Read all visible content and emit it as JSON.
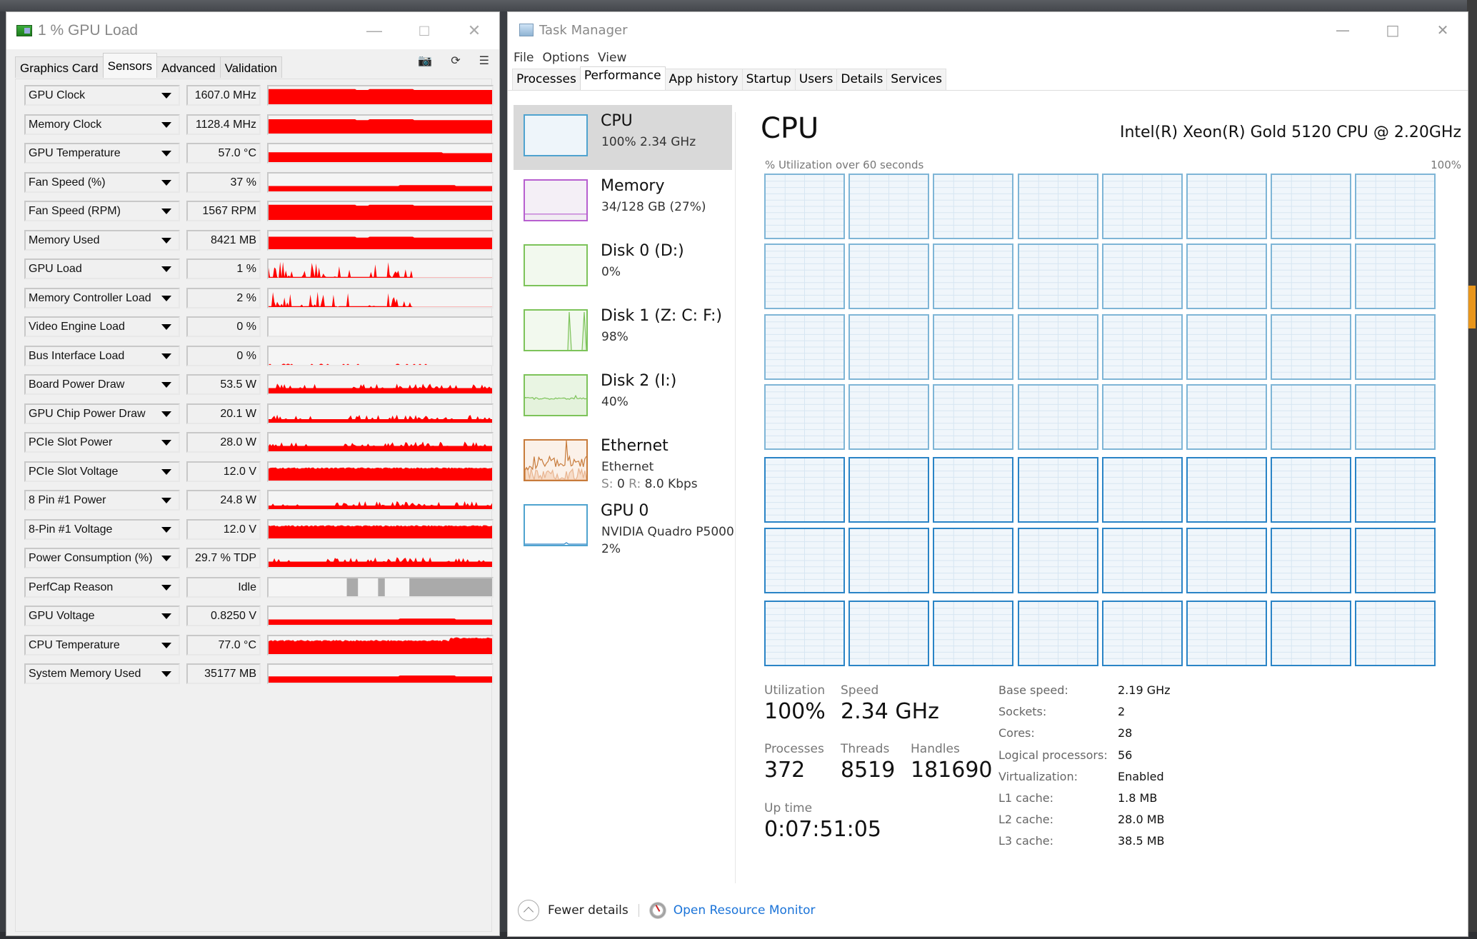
{
  "gpuz": {
    "title": "1 % GPU Load",
    "tabs": [
      {
        "label": "Graphics Card",
        "active": false
      },
      {
        "label": "Sensors",
        "active": true
      },
      {
        "label": "Advanced",
        "active": false
      },
      {
        "label": "Validation",
        "active": false
      }
    ],
    "tool_icons": [
      "camera-icon",
      "refresh-icon",
      "menu-icon"
    ],
    "graph_color": "#ff0000",
    "sensors": [
      {
        "name": "GPU Clock",
        "value": "1607.0 MHz",
        "graph": "flat-high",
        "level": 0.85
      },
      {
        "name": "Memory Clock",
        "value": "1128.4 MHz",
        "graph": "flat-high",
        "level": 0.8
      },
      {
        "name": "GPU Temperature",
        "value": "57.0 °C",
        "graph": "flat-mid",
        "level": 0.55
      },
      {
        "name": "Fan Speed (%)",
        "value": "37 %",
        "graph": "flat-low",
        "level": 0.3
      },
      {
        "name": "Fan Speed (RPM)",
        "value": "1567 RPM",
        "graph": "flat-high",
        "level": 0.85
      },
      {
        "name": "Memory Used",
        "value": "8421 MB",
        "graph": "flat-high",
        "level": 0.7
      },
      {
        "name": "GPU Load",
        "value": "1 %",
        "graph": "spiky",
        "level": 0.02
      },
      {
        "name": "Memory Controller Load",
        "value": "2 %",
        "graph": "spiky",
        "level": 0.05
      },
      {
        "name": "Video Engine Load",
        "value": "0 %",
        "graph": "empty",
        "level": 0
      },
      {
        "name": "Bus Interface Load",
        "value": "0 %",
        "graph": "dots",
        "level": 0.02
      },
      {
        "name": "Board Power Draw",
        "value": "53.5 W",
        "graph": "power",
        "level": 0.3
      },
      {
        "name": "GPU Chip Power Draw",
        "value": "20.1 W",
        "graph": "power",
        "level": 0.2
      },
      {
        "name": "PCIe Slot Power",
        "value": "28.0 W",
        "graph": "power",
        "level": 0.3
      },
      {
        "name": "PCIe Slot Voltage",
        "value": "12.0 V",
        "graph": "noisy-high",
        "level": 0.7
      },
      {
        "name": "8 Pin #1 Power",
        "value": "24.8 W",
        "graph": "power",
        "level": 0.2
      },
      {
        "name": "8-Pin #1 Voltage",
        "value": "12.0 V",
        "graph": "noisy-high",
        "level": 0.7
      },
      {
        "name": "Power Consumption (%)",
        "value": "29.7 % TDP",
        "graph": "power",
        "level": 0.3
      },
      {
        "name": "PerfCap Reason",
        "value": "Idle",
        "graph": "perfcap",
        "level": 0
      },
      {
        "name": "GPU Voltage",
        "value": "0.8250 V",
        "graph": "flat-low",
        "level": 0.3
      },
      {
        "name": "CPU Temperature",
        "value": "77.0 °C",
        "graph": "noisy-high",
        "level": 0.75
      },
      {
        "name": "System Memory Used",
        "value": "35177 MB",
        "graph": "flat-low",
        "level": 0.35
      }
    ]
  },
  "taskmanager": {
    "title": "Task Manager",
    "menu": [
      "File",
      "Options",
      "View"
    ],
    "tabs": [
      {
        "label": "Processes",
        "active": false
      },
      {
        "label": "Performance",
        "active": true
      },
      {
        "label": "App history",
        "active": false
      },
      {
        "label": "Startup",
        "active": false
      },
      {
        "label": "Users",
        "active": false
      },
      {
        "label": "Details",
        "active": false
      },
      {
        "label": "Services",
        "active": false
      }
    ],
    "sidebar": [
      {
        "label": "CPU",
        "sub": "100%  2.34 GHz",
        "color": "#4fa3cf",
        "fill": "#eef5fa",
        "active": true
      },
      {
        "label": "Memory",
        "sub": "34/128 GB (27%)",
        "color": "#b75fcf",
        "fill": "#f4eff6",
        "active": false,
        "usage": 0.27
      },
      {
        "label": "Disk 0 (D:)",
        "sub": "0%",
        "color": "#7dc35a",
        "fill": "#f2f9ee",
        "active": false,
        "usage": 0
      },
      {
        "label": "Disk 1 (Z: C: F:)",
        "sub": "98%",
        "color": "#7dc35a",
        "fill": "#f2f9ee",
        "active": false,
        "usage": 0.98
      },
      {
        "label": "Disk 2 (I:)",
        "sub": "40%",
        "color": "#7dc35a",
        "fill": "#e9f5e3",
        "active": false,
        "usage": 0.4
      },
      {
        "label": "Ethernet",
        "sub": "Ethernet",
        "sub2_send_label": "S:",
        "sub2_send": "0",
        "sub2_recv_label": "R:",
        "sub2_recv": "8.0 Kbps",
        "color": "#c77b3b",
        "fill": "#fbf1e9",
        "active": false
      },
      {
        "label": "GPU 0",
        "sub": "NVIDIA Quadro P5000",
        "sub2": "2%",
        "color": "#4fa3cf",
        "fill": "#ffffff",
        "active": false,
        "usage": 0.02
      }
    ],
    "main": {
      "heading": "CPU",
      "cpu_model": "Intel(R) Xeon(R) Gold 5120 CPU @ 2.20GHz",
      "graph_label": "% Utilization over 60 seconds",
      "graph_max": "100%",
      "logical_processor_graphs": 56,
      "grid_columns": 8,
      "grid_rows": 7,
      "stats": {
        "utilization_label": "Utilization",
        "utilization": "100%",
        "speed_label": "Speed",
        "speed": "2.34 GHz",
        "processes_label": "Processes",
        "processes": "372",
        "threads_label": "Threads",
        "threads": "8519",
        "handles_label": "Handles",
        "handles": "181690",
        "uptime_label": "Up time",
        "uptime": "0:07:51:05"
      },
      "details": [
        {
          "label": "Base speed:",
          "value": "2.19 GHz"
        },
        {
          "label": "Sockets:",
          "value": "2"
        },
        {
          "label": "Cores:",
          "value": "28"
        },
        {
          "label": "Logical processors:",
          "value": "56"
        },
        {
          "label": "Virtualization:",
          "value": "Enabled"
        },
        {
          "label": "L1 cache:",
          "value": "1.8 MB"
        },
        {
          "label": "L2 cache:",
          "value": "28.0 MB"
        },
        {
          "label": "L3 cache:",
          "value": "38.5 MB"
        }
      ]
    },
    "footer": {
      "fewer_details": "Fewer details",
      "open_resource_monitor": "Open Resource Monitor"
    }
  }
}
